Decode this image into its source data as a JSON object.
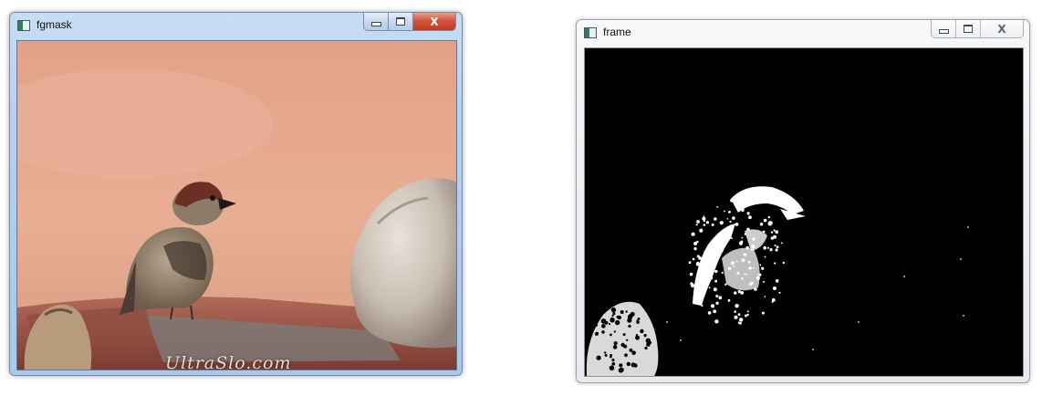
{
  "windows": {
    "left": {
      "title": "fgmask",
      "icon": "window-app-icon",
      "controls": {
        "minimize": "minimize-icon",
        "maximize": "maximize-icon",
        "close": "close-icon",
        "close_glyph": "X"
      },
      "watermark": "UltraSlo.com"
    },
    "right": {
      "title": "frame",
      "icon": "window-app-icon",
      "controls": {
        "minimize": "minimize-icon",
        "maximize": "maximize-icon",
        "close": "close-icon",
        "close_glyph": "X"
      }
    }
  },
  "colors": {
    "background_peach": "#e7a88e",
    "close_button_red": "#c94a2f",
    "mask_background": "#000000",
    "mask_foreground": "#ffffff"
  }
}
